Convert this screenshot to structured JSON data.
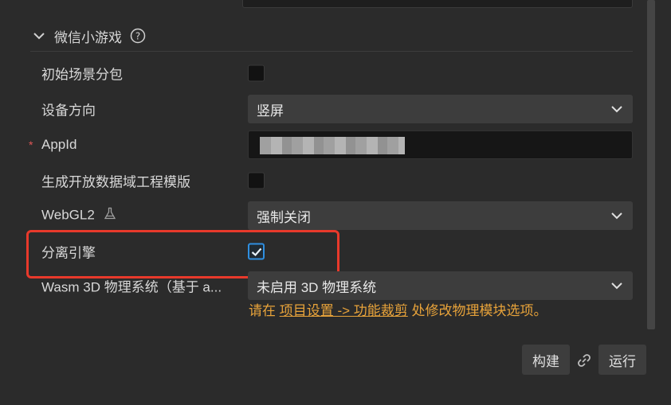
{
  "section": {
    "title": "微信小游戏"
  },
  "rows": {
    "initial_scene_subpackage": {
      "label": "初始场景分包",
      "checked": false
    },
    "device_orientation": {
      "label": "设备方向",
      "value": "竖屏"
    },
    "appid": {
      "label": "AppId",
      "required": "*",
      "value": ""
    },
    "open_data_template": {
      "label": "生成开放数据域工程模版",
      "checked": false
    },
    "webgl2": {
      "label": "WebGL2",
      "value": "强制关闭"
    },
    "separate_engine": {
      "label": "分离引擎",
      "checked": true
    },
    "wasm_physics": {
      "label": "Wasm 3D 物理系统（基于 a...",
      "value": "未启用 3D 物理系统"
    }
  },
  "hint": {
    "prefix": "请在 ",
    "link": "项目设置 -> 功能裁剪",
    "suffix": " 处修改物理模块选项。"
  },
  "footer": {
    "build_label": "构建",
    "run_label": "运行"
  },
  "colors": {
    "accent": "#2f8fe0",
    "highlight": "#e8392b",
    "hint": "#e8a33a"
  }
}
